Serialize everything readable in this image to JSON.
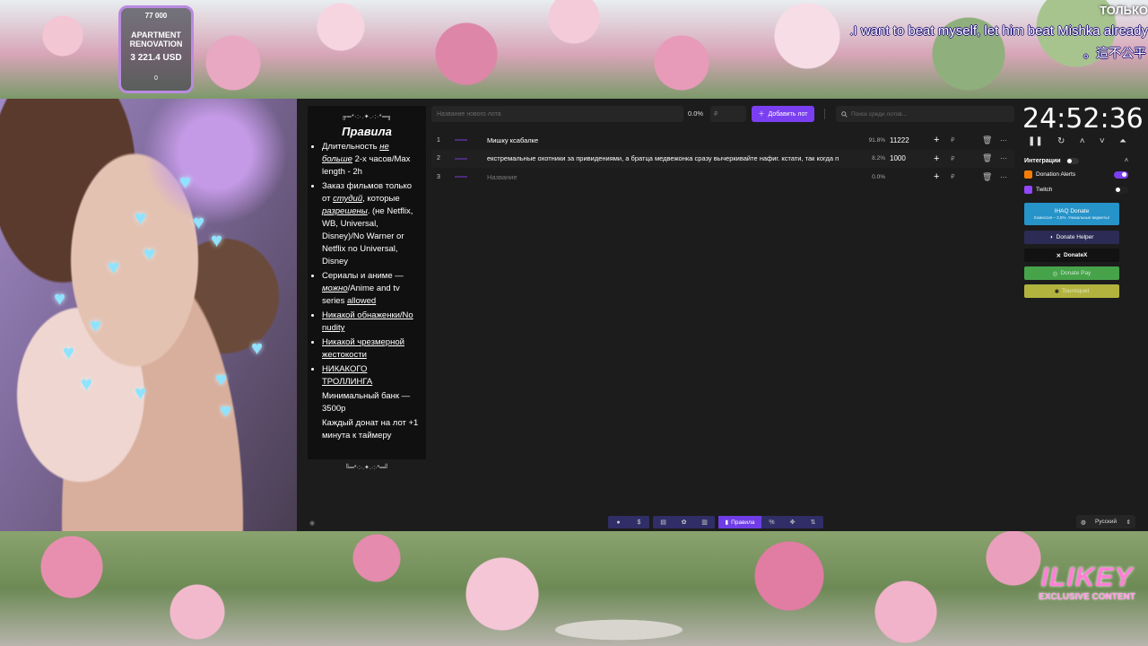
{
  "overlay": {
    "goal": {
      "top_value": "77 000",
      "title": "APARTMENT RENOVATION",
      "amount": "3 221.4 USD",
      "bottom_value": "0",
      "border_color": "#b98be0"
    },
    "chat": {
      "line1": "ТОЛЬКО",
      "line2": ".I want to beat myself, let him beat Mishka already",
      "line3": "。這不公平"
    },
    "logo": {
      "line1": "ILIKEY",
      "line2": "EXCLUSIVE CONTENT",
      "color": "#ff7fd6"
    }
  },
  "rules": {
    "deco_top": "╔═*·:·.✦.·:·*═╗",
    "title": "Правила",
    "items": [
      {
        "prefix": "Длительность ",
        "emph": "не больше",
        "suffix": " 2-х часов/Max length - 2h"
      },
      {
        "prefix": "Заказ фильмов только от ",
        "emph": "студий",
        "mid": ", которые ",
        "emph2": "разрешены",
        "suffix": ". (не Netflix, WB, Universal, Disney)/No Warner or Netflix no Universal, Disney"
      },
      {
        "prefix": "Сериалы и аниме — ",
        "emph": "можно",
        "mid": "/Anime and tv series ",
        "emph2": "allowed"
      },
      {
        "underlined": "Никакой обнаженки/No nudity"
      },
      {
        "underlined": "Никакой чрезмерной жестокости"
      },
      {
        "underlined": "НИКАКОГО ТРОЛЛИНГА"
      }
    ],
    "plain_lines": [
      "Минимальный банк — 3500р",
      "Каждый донат на лот +1 минута к таймеру"
    ],
    "deco_bottom": "╚═*·:·.✦.·:·*═╝"
  },
  "toolbar": {
    "lot_placeholder": "Название нового лота",
    "percent": "0.0%",
    "amount_placeholder": "₽",
    "add_label": "Добавить лот",
    "search_placeholder": "Поиск среди лотов..."
  },
  "lots": [
    {
      "index": "1",
      "name": "Мишку ксабалке",
      "percent": "91.8%",
      "amount": "11222",
      "currency": "₽"
    },
    {
      "index": "2",
      "name": "екстремальные охотники за привидениями, а братца медвежонка сразу вычеркивайте нафиг. кстати, так когда п",
      "percent": "8.2%",
      "amount": "1000",
      "currency": "₽"
    },
    {
      "index": "3",
      "name": "Название",
      "percent": "0.0%",
      "amount": "",
      "currency": "₽"
    }
  ],
  "timer": {
    "value": "24:52:36"
  },
  "integrations": {
    "title": "Интеграции",
    "items": [
      {
        "label": "Donation Alerts",
        "icon": "donation-alerts-icon",
        "enabled": true,
        "color": "#f57d07"
      },
      {
        "label": "Twitch",
        "icon": "twitch-icon",
        "enabled": false,
        "color": "#9146ff"
      }
    ],
    "buttons": {
      "ihaq": "IHAQ Donate",
      "ihaq_sub": "Комиссия – 3,5%. Уникальные виджеты!",
      "helper": "Donate Helper",
      "donatex": "DonateX",
      "donatepay": "Donate Pay",
      "tourniquet": "Tourniquet"
    }
  },
  "bottom_bar": {
    "rules_label": "Правила",
    "language": "Русский"
  },
  "colors": {
    "accent": "#7b3ff2",
    "panel_bg": "#1c1c1c",
    "rules_bg": "#101010"
  }
}
